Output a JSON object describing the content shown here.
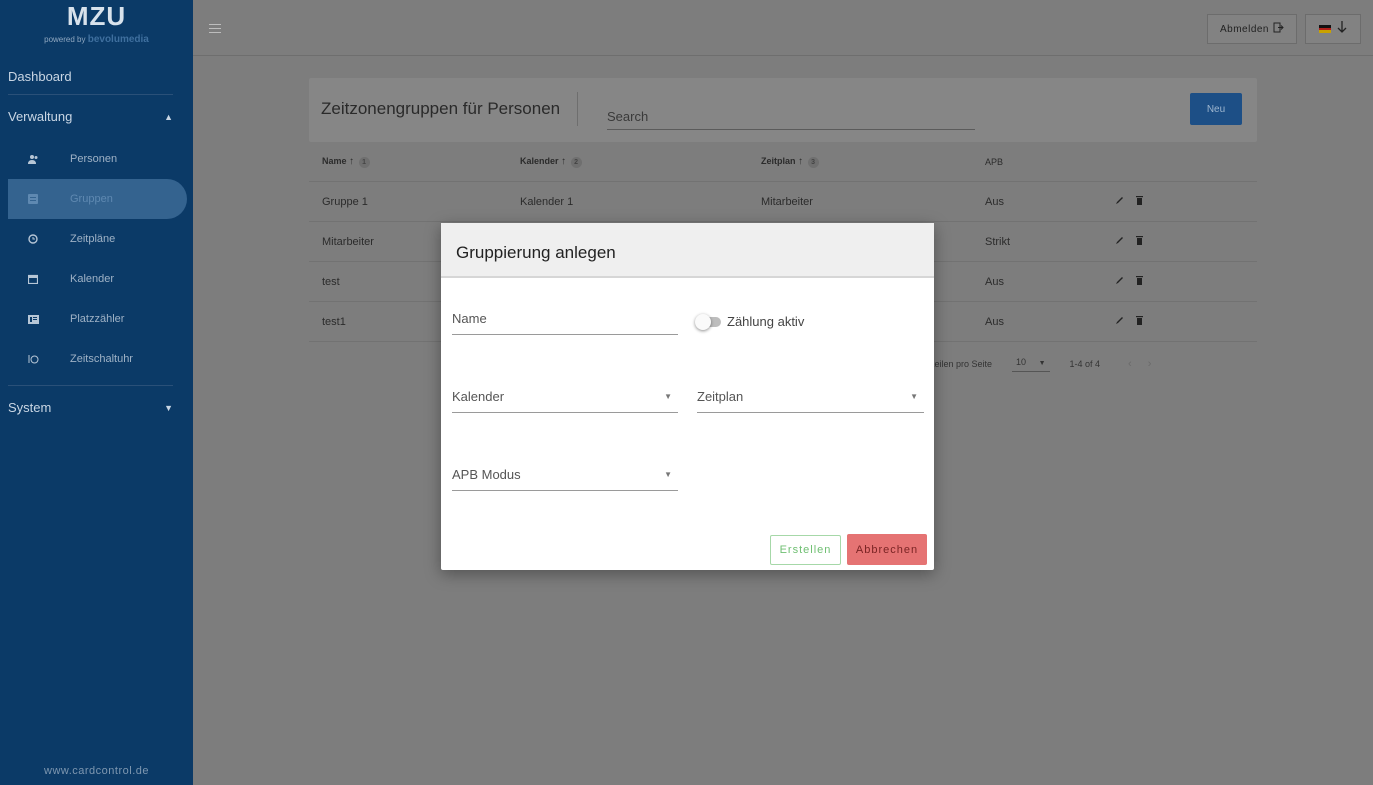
{
  "sidebar": {
    "logo_title": "MZU",
    "logo_powered": "powered by",
    "logo_brand": "bevolumedia",
    "dashboard_label": "Dashboard",
    "verwaltung_label": "Verwaltung",
    "system_label": "System",
    "items": [
      {
        "label": "Personen",
        "icon": "people-icon"
      },
      {
        "label": "Gruppen",
        "icon": "group-icon"
      },
      {
        "label": "Zeitpläne",
        "icon": "clock-icon"
      },
      {
        "label": "Kalender",
        "icon": "calendar-icon"
      },
      {
        "label": "Platzzähler",
        "icon": "counter-icon"
      },
      {
        "label": "Zeitschaltuhr",
        "icon": "timer-icon"
      }
    ],
    "footer": "www.cardcontrol.de"
  },
  "topbar": {
    "logout_label": "Abmelden",
    "lang_flag": "de-flag-icon"
  },
  "card": {
    "title": "Zeitzonengruppen für Personen",
    "search_placeholder": "Search",
    "new_label": "Neu"
  },
  "table": {
    "headers": {
      "name": "Name",
      "name_sort": "1",
      "kalender": "Kalender",
      "kalender_sort": "2",
      "zeitplan": "Zeitplan",
      "zeitplan_sort": "3",
      "apb": "APB"
    },
    "rows": [
      {
        "name": "Gruppe 1",
        "kalender": "Kalender 1",
        "zeitplan": "Mitarbeiter",
        "apb": "Aus"
      },
      {
        "name": "Mitarbeiter",
        "kalender": "",
        "zeitplan": "",
        "apb": "Strikt"
      },
      {
        "name": "test",
        "kalender": "",
        "zeitplan": "",
        "apb": "Aus"
      },
      {
        "name": "test1",
        "kalender": "",
        "zeitplan": "",
        "apb": "Aus"
      }
    ],
    "pager": {
      "rows_per_page_label": "Zeilen pro Seite",
      "rows_per_page_value": "10",
      "range": "1-4 of 4"
    }
  },
  "dialog": {
    "title": "Gruppierung anlegen",
    "name_label": "Name",
    "toggle_label": "Zählung aktiv",
    "kalender_label": "Kalender",
    "zeitplan_label": "Zeitplan",
    "apb_label": "APB Modus",
    "create_label": "Erstellen",
    "cancel_label": "Abbrechen"
  }
}
